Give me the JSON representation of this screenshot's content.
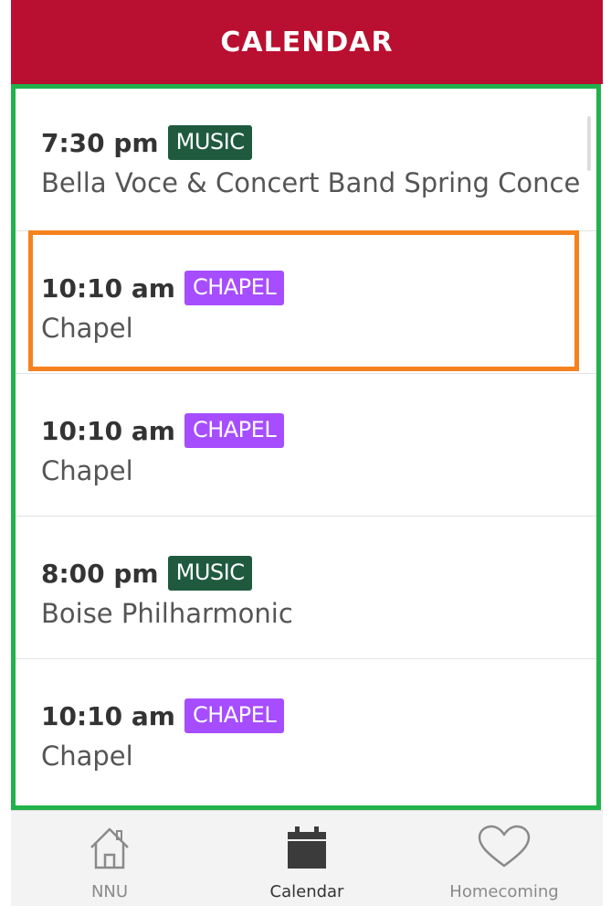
{
  "header": {
    "title": "CALENDAR"
  },
  "colors": {
    "header_bg": "#b90f30",
    "music_badge": "#1f5a3f",
    "chapel_badge": "#a64dff"
  },
  "events": [
    {
      "time": "7:30 pm",
      "category": "MUSIC",
      "title": "Bella Voce & Concert Band Spring Conce"
    },
    {
      "time": "10:10 am",
      "category": "CHAPEL",
      "title": "Chapel"
    },
    {
      "time": "10:10 am",
      "category": "CHAPEL",
      "title": "Chapel"
    },
    {
      "time": "8:00 pm",
      "category": "MUSIC",
      "title": "Boise Philharmonic"
    },
    {
      "time": "10:10 am",
      "category": "CHAPEL",
      "title": "Chapel"
    }
  ],
  "tabs": [
    {
      "label": "NNU",
      "icon": "home-icon"
    },
    {
      "label": "Calendar",
      "icon": "calendar-icon"
    },
    {
      "label": "Homecoming",
      "icon": "heart-icon"
    }
  ],
  "selected_tab": "Calendar"
}
